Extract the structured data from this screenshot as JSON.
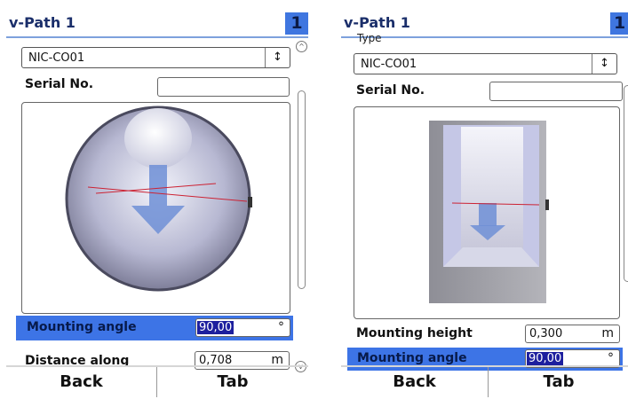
{
  "left_panel": {
    "title": "v-Path 1",
    "badge": "1",
    "cut_label": "' '",
    "type_select": {
      "value": "NIC-CO01",
      "arrow": "↕"
    },
    "serial_label": "Serial No.",
    "serial_value": "",
    "mounting_angle_label": "Mounting angle",
    "mounting_angle_value": "90,00",
    "mounting_angle_unit": "°",
    "distance_label": "Distance along",
    "distance_value": "0,708",
    "distance_unit": "m",
    "back_label": "Back",
    "tab_label": "Tab"
  },
  "right_panel": {
    "title": "v-Path 1",
    "badge": "1",
    "cut_label": "Type",
    "type_select": {
      "value": "NIC-CO01",
      "arrow": "↕"
    },
    "serial_label": "Serial No.",
    "serial_value": "",
    "mounting_height_label": "Mounting height",
    "mounting_height_value": "0,300",
    "mounting_height_unit": "m",
    "mounting_angle_label": "Mounting angle",
    "mounting_angle_value": "90,00",
    "mounting_angle_unit": "°",
    "back_label": "Back",
    "tab_label": "Tab"
  },
  "icons": {
    "pipe_illustration": "round-pipe-sensor-illustration",
    "channel_illustration": "rectangular-channel-sensor-illustration"
  },
  "colors": {
    "accent": "#3d74e6",
    "selection": "#1d1f9e",
    "title": "#1a2e6a"
  }
}
